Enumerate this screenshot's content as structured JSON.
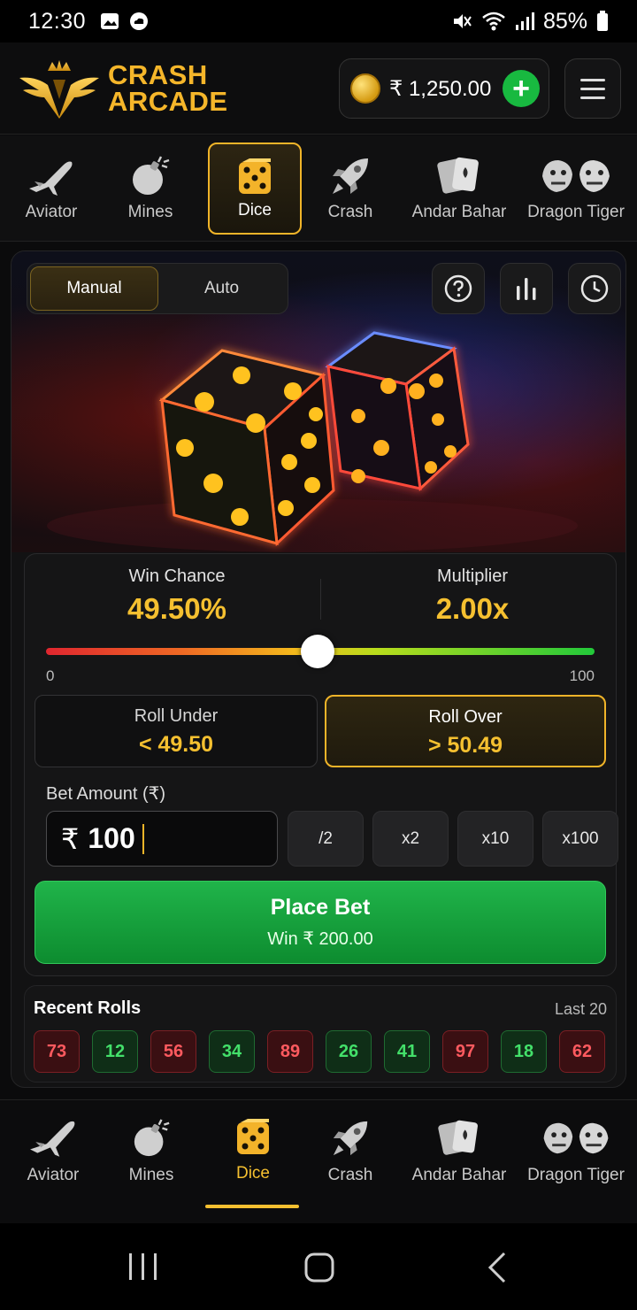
{
  "status_bar": {
    "time": "12:30",
    "battery": "85%"
  },
  "header": {
    "logo_line1": "CRASH",
    "logo_line2": "ARCADE",
    "balance": "₹ 1,250.00",
    "add_icon": "plus-icon",
    "menu_icon": "hamburger-icon"
  },
  "game_tabs": [
    {
      "label": "Aviator",
      "icon": "plane-icon"
    },
    {
      "label": "Mines",
      "icon": "bomb-icon"
    },
    {
      "label": "Dice",
      "icon": "dice-icon",
      "active": true
    },
    {
      "label": "Crash",
      "icon": "rocket-icon"
    },
    {
      "label": "Andar Bahar",
      "icon": "cards-icon"
    },
    {
      "label": "Dragon Tiger",
      "icon": "dragon-tiger-icon"
    }
  ],
  "game": {
    "modes": [
      "Manual",
      "Auto"
    ],
    "active_mode": "Manual",
    "toolbar_icons": [
      "help-icon",
      "stats-icon",
      "history-icon"
    ],
    "win_chance_label": "Win Chance",
    "win_chance": "49.50%",
    "multiplier_label": "Multiplier",
    "multiplier": "2.00x",
    "slider": {
      "min": "0",
      "max": "100",
      "value": 49.5
    },
    "roll_under_label": "Roll Under",
    "roll_under_value": "< 49.50",
    "roll_over_label": "Roll Over",
    "roll_over_value": "> 50.49",
    "active_roll": "over",
    "bet_label": "Bet Amount (₹)",
    "currency_symbol": "₹",
    "bet_amount": "100",
    "quick_buttons": [
      "/2",
      "x2",
      "x10",
      "x100"
    ],
    "place_bet_label": "Place Bet",
    "win_amount": "Win ₹ 200.00"
  },
  "recent_rolls": {
    "title": "Recent Rolls",
    "subtitle": "Last 20",
    "rolls": [
      {
        "value": "73",
        "result": "loss"
      },
      {
        "value": "12",
        "result": "win"
      },
      {
        "value": "56",
        "result": "loss"
      },
      {
        "value": "34",
        "result": "win"
      },
      {
        "value": "89",
        "result": "loss"
      },
      {
        "value": "26",
        "result": "win"
      },
      {
        "value": "41",
        "result": "win"
      },
      {
        "value": "97",
        "result": "loss"
      },
      {
        "value": "18",
        "result": "win"
      },
      {
        "value": "62",
        "result": "loss"
      }
    ]
  },
  "bottom_nav": [
    {
      "label": "Aviator"
    },
    {
      "label": "Mines"
    },
    {
      "label": "Dice",
      "active": true
    },
    {
      "label": "Crash"
    },
    {
      "label": "Andar Bahar"
    },
    {
      "label": "Dragon Tiger"
    }
  ],
  "colors": {
    "accent": "#f5c030",
    "win": "#43e06a",
    "loss": "#ff5a5f",
    "cta": "#18b940"
  }
}
